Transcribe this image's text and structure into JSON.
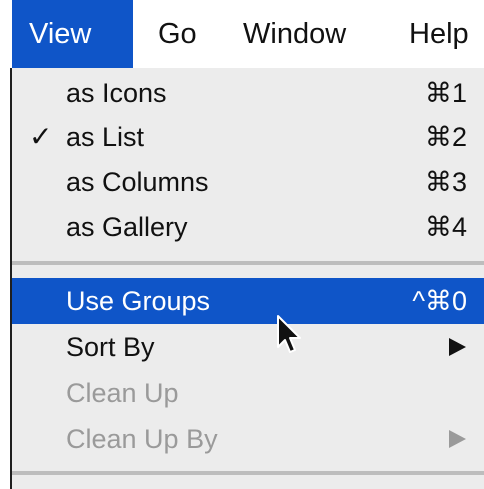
{
  "menubar": {
    "items": [
      {
        "label": "View",
        "active": true
      },
      {
        "label": "Go",
        "active": false
      },
      {
        "label": "Window",
        "active": false
      },
      {
        "label": "Help",
        "active": false
      }
    ]
  },
  "menu": {
    "items": [
      {
        "label": "as Icons",
        "shortcut": "⌘1",
        "checked": false,
        "enabled": true
      },
      {
        "label": "as List",
        "shortcut": "⌘2",
        "checked": true,
        "check_mark": "✓",
        "enabled": true
      },
      {
        "label": "as Columns",
        "shortcut": "⌘3",
        "checked": false,
        "enabled": true
      },
      {
        "label": "as Gallery",
        "shortcut": "⌘4",
        "checked": false,
        "enabled": true
      },
      {
        "label": "Use Groups",
        "shortcut": "^⌘0",
        "enabled": true,
        "highlighted": true
      },
      {
        "label": "Sort By",
        "submenu": true,
        "enabled": true
      },
      {
        "label": "Clean Up",
        "enabled": false
      },
      {
        "label": "Clean Up By",
        "submenu": true,
        "enabled": false
      }
    ]
  },
  "colors": {
    "highlight": "#0f55c8",
    "menu_background": "#ececec",
    "disabled_text": "#9a9a9a"
  },
  "icons": {
    "submenu": "triangle-right-icon",
    "cursor": "arrow-cursor-icon"
  }
}
